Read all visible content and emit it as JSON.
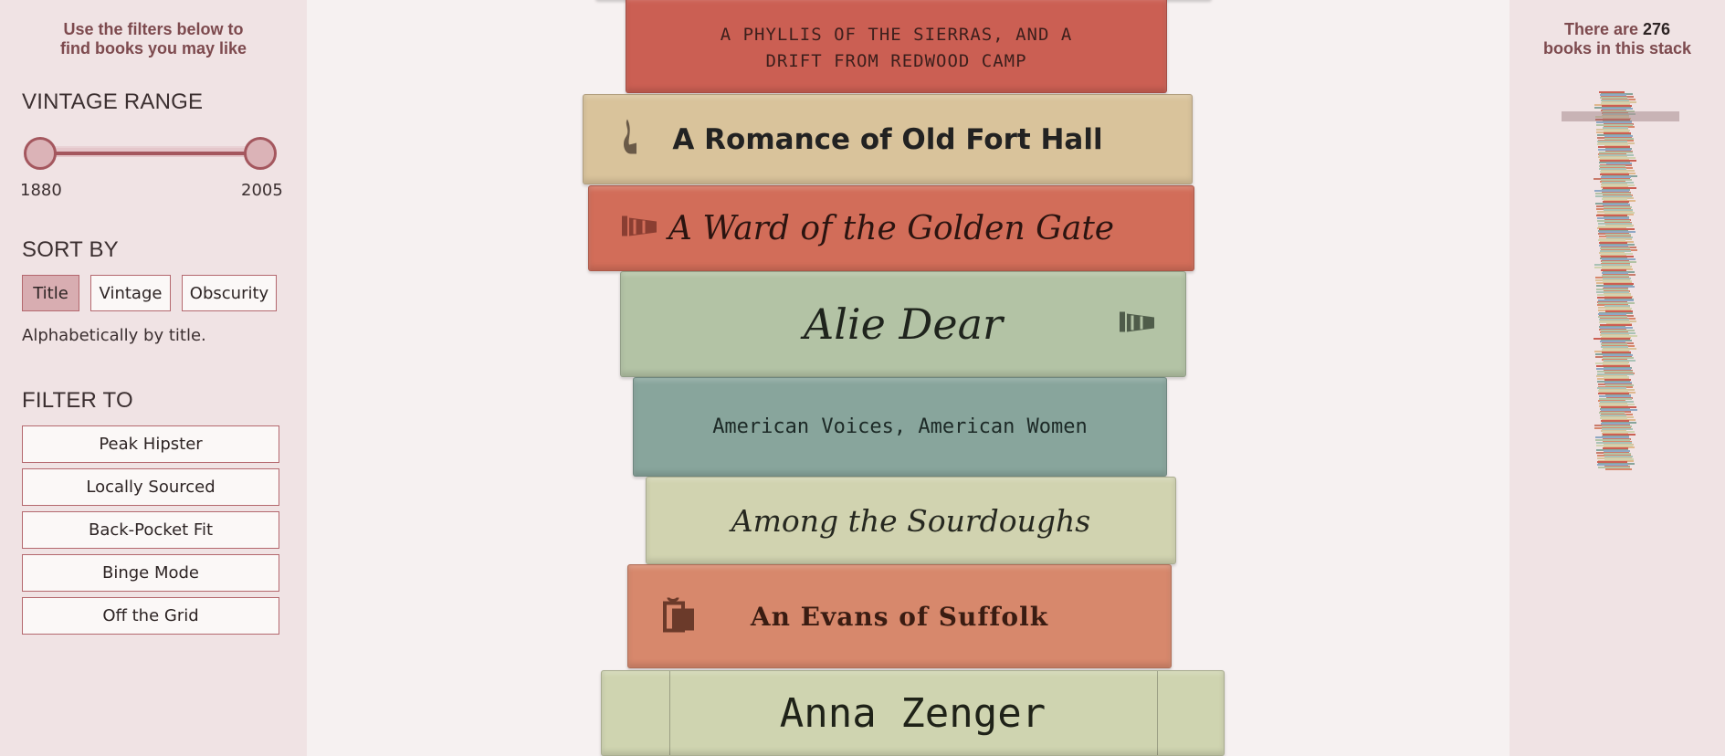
{
  "sidebar": {
    "intro_line1": "Use the filters below to",
    "intro_line2": "find books you may like",
    "vintage_title": "VINTAGE RANGE",
    "range_min": "1880",
    "range_max": "2005",
    "sort_title": "SORT BY",
    "sort_buttons": [
      "Title",
      "Vintage",
      "Obscurity"
    ],
    "sort_active": "Title",
    "sort_description": "Alphabetically by title.",
    "filter_title": "FILTER TO",
    "filters": [
      "Peak Hipster",
      "Locally Sourced",
      "Back-Pocket Fit",
      "Binge Mode",
      "Off the Grid"
    ]
  },
  "right_panel": {
    "count_prefix": "There are ",
    "count": "276",
    "count_suffix_line1": "",
    "count_line2": "books in this stack"
  },
  "books": [
    {
      "title_line1": "A PHYLLIS OF THE SIERRAS, AND A",
      "title_line2": "DRIFT FROM REDWOOD CAMP",
      "color": "#cb5f53",
      "icon": ""
    },
    {
      "title_line1": "A Romance of Old Fort Hall",
      "title_line2": "",
      "color": "#d9c39b",
      "icon": "pipe-icon"
    },
    {
      "title_line1": "A Ward of the Golden Gate",
      "title_line2": "",
      "color": "#d26d59",
      "icon": "megaphone-icon"
    },
    {
      "title_line1": "Alie Dear",
      "title_line2": "",
      "color": "#b3c3a5",
      "icon": "megaphone-icon"
    },
    {
      "title_line1": "American Voices, American Women",
      "title_line2": "",
      "color": "#88a59c",
      "icon": ""
    },
    {
      "title_line1": "Among the Sourdoughs",
      "title_line2": "",
      "color": "#d1d3b0",
      "icon": ""
    },
    {
      "title_line1": "An Evans of Suffolk",
      "title_line2": "",
      "color": "#d7886c",
      "icon": "beer-mug-icon"
    },
    {
      "title_line1": "Anna Zenger",
      "title_line2": "",
      "color": "#cfd4b0",
      "icon": ""
    }
  ],
  "colors": {
    "accent": "#a4575e",
    "sidebar_bg": "#f0e3e4",
    "main_bg": "#f6f1f1"
  }
}
